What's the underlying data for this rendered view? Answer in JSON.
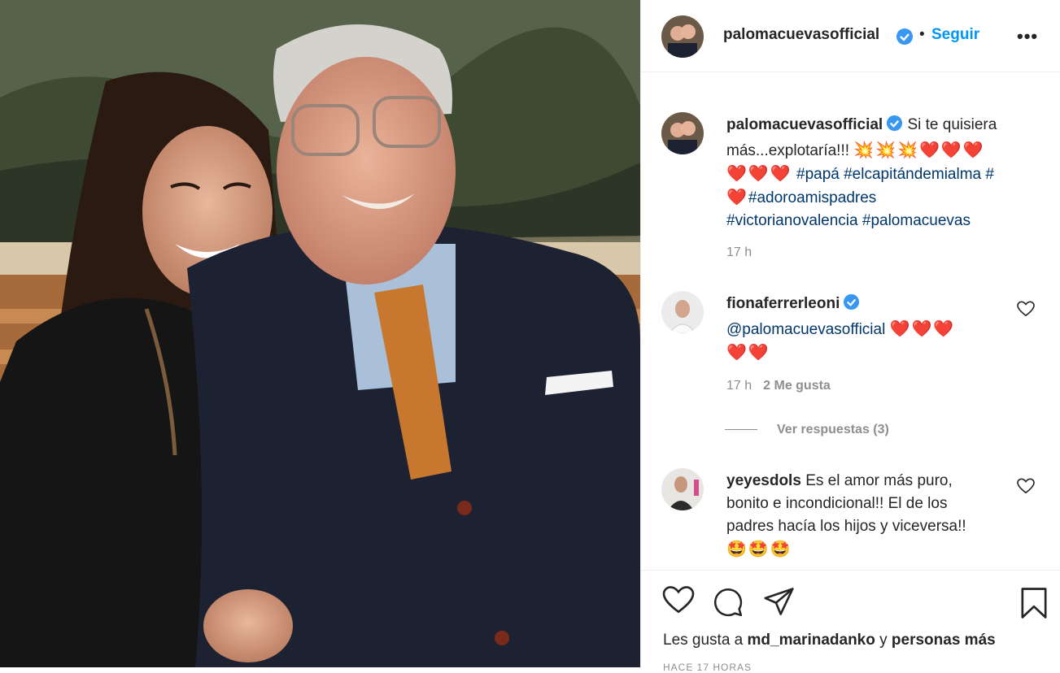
{
  "post": {
    "author": "palomacuevasofficial",
    "follow_label": "Seguir",
    "separator": "•",
    "more_label": "•••"
  },
  "caption": {
    "username": "palomacuevasofficial",
    "text": "Si te quisiera más...explotaría!!!",
    "emojis_line1": "💥💥💥❤️❤️❤️",
    "emojis_line2": "❤️❤️❤️",
    "hashtags_line2": "#papá #elcapitándemialma #",
    "emojis_line3": "❤️",
    "hashtags_line3": "#adoroamispadres",
    "hashtags_line4": "#victorianovalencia #palomacuevas",
    "time": "17 h"
  },
  "comments": [
    {
      "username": "fionaferrerleoni",
      "mention": "@palomacuevasofficial",
      "emojis_a": "❤️❤️❤️",
      "emojis_b": "❤️❤️",
      "time": "17 h",
      "likes": "2 Me gusta",
      "replies": "Ver respuestas (3)"
    },
    {
      "username": "yeyesdols",
      "line1": "Es el amor más puro,",
      "line2": "bonito e incondicional!! El de los",
      "line3": "padres hacía los hijos y viceversa!!",
      "emojis": "🤩🤩🤩"
    }
  ],
  "likes": {
    "prefix": "Les gusta a",
    "user": "md_marinadanko",
    "middle": "y",
    "rest": "personas más"
  },
  "timestamp": "HACE 17 HORAS",
  "colors": {
    "link": "#0095f6",
    "hashtag": "#00376b",
    "heart": "#ed4956",
    "verified": "#3897f0"
  }
}
